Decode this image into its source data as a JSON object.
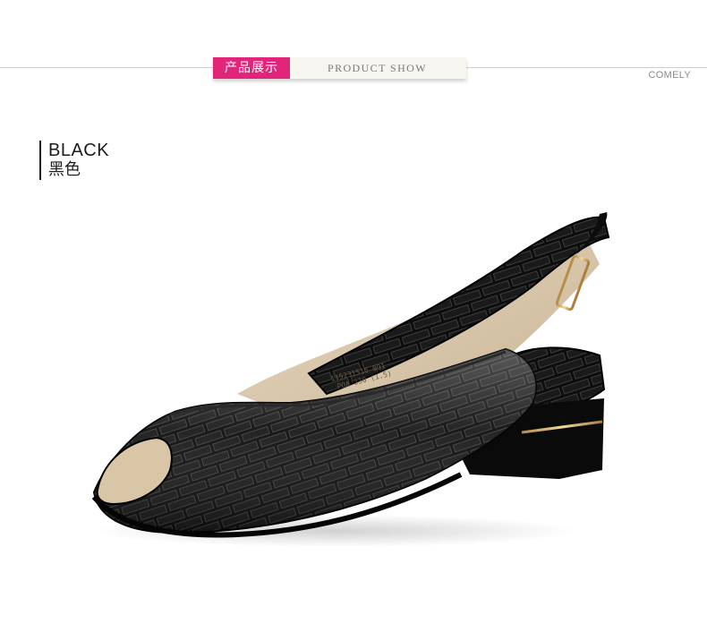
{
  "header": {
    "title_cn": "产品展示",
    "title_en": "PRODUCT SHOW",
    "brand": "COMELY",
    "accent_color": "#e2247a"
  },
  "product": {
    "color_en": "BLACK",
    "color_cn": "黑色",
    "insole_line1": "115231516 001",
    "insole_line2": "POA 230 (1.5)",
    "image": "black-patent-croc-slingback-peep-toe-shoe"
  }
}
